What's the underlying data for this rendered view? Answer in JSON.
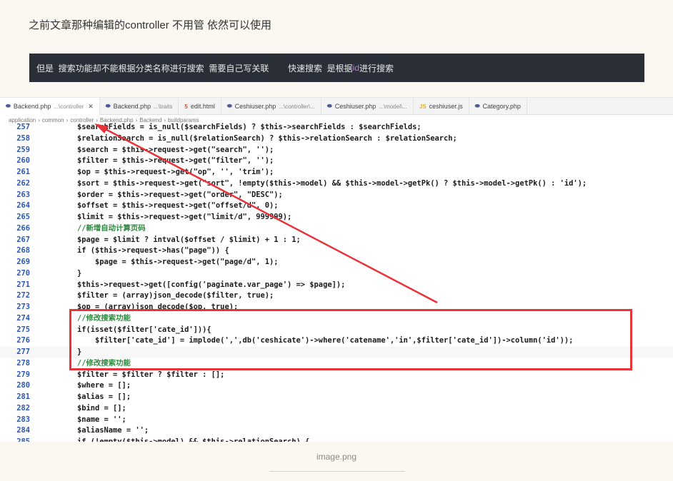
{
  "intro_text": "之前文章那种编辑的controller 不用管 依然可以使用",
  "quote": {
    "part1": "但是  搜索功能却不能根据分类名称进行搜索  需要自己写关联        快速搜索  是根据",
    "highlight": "id",
    "part2": "进行搜索"
  },
  "editor": {
    "tabs": [
      {
        "icon": "php-file-icon",
        "name": "Backend.php",
        "path": "...\\controller",
        "active": true,
        "close": "✕",
        "type": "php"
      },
      {
        "icon": "php-file-icon",
        "name": "Backend.php",
        "path": "...\\traits",
        "active": false,
        "type": "php"
      },
      {
        "icon": "html-file-icon",
        "name": "edit.html",
        "path": "",
        "active": false,
        "type": "html"
      },
      {
        "icon": "php-file-icon",
        "name": "Ceshiuser.php",
        "path": "...\\controller\\...",
        "active": false,
        "type": "php"
      },
      {
        "icon": "php-file-icon",
        "name": "Ceshiuser.php",
        "path": "...\\model\\...",
        "active": false,
        "type": "php"
      },
      {
        "icon": "js-file-icon",
        "name": "ceshiuser.js",
        "path": "",
        "active": false,
        "type": "js"
      },
      {
        "icon": "php-file-icon",
        "name": "Category.php",
        "path": "",
        "active": false,
        "type": "php"
      }
    ],
    "breadcrumb": [
      "application",
      "common",
      "controller",
      "Backend.php",
      "Backend",
      "buildparams"
    ],
    "code_lines": [
      {
        "n": "257",
        "t": "$searchFields = is_null($searchFields) ? $this->searchFields : $searchFields;"
      },
      {
        "n": "258",
        "t": "$relationSearch = is_null($relationSearch) ? $this->relationSearch : $relationSearch;"
      },
      {
        "n": "259",
        "t": "$search = $this->request->get(\"search\", '');"
      },
      {
        "n": "260",
        "t": "$filter = $this->request->get(\"filter\", '');"
      },
      {
        "n": "261",
        "t": "$op = $this->request->get(\"op\", '', 'trim');"
      },
      {
        "n": "262",
        "t": "$sort = $this->request->get(\"sort\", !empty($this->model) && $this->model->getPk() ? $this->model->getPk() : 'id');"
      },
      {
        "n": "263",
        "t": "$order = $this->request->get(\"order\", \"DESC\");"
      },
      {
        "n": "264",
        "t": "$offset = $this->request->get(\"offset/d\", 0);"
      },
      {
        "n": "265",
        "t": "$limit = $this->request->get(\"limit/d\", 999999);"
      },
      {
        "n": "266",
        "t": "//新增自动计算页码"
      },
      {
        "n": "267",
        "t": "$page = $limit ? intval($offset / $limit) + 1 : 1;"
      },
      {
        "n": "268",
        "t": "if ($this->request->has(\"page\")) {"
      },
      {
        "n": "269",
        "t": "    $page = $this->request->get(\"page/d\", 1);"
      },
      {
        "n": "270",
        "t": "}"
      },
      {
        "n": "271",
        "t": "$this->request->get([config('paginate.var_page') => $page]);"
      },
      {
        "n": "272",
        "t": "$filter = (array)json_decode($filter, true);"
      },
      {
        "n": "273",
        "t": "$op = (array)json_decode($op, true);"
      },
      {
        "n": "274",
        "t": "//修改搜索功能"
      },
      {
        "n": "275",
        "t": "if(isset($filter['cate_id'])){"
      },
      {
        "n": "276",
        "t": "    $filter['cate_id'] = implode(',',db('ceshicate')->where('catename','in',$filter['cate_id'])->column('id'));"
      },
      {
        "n": "277",
        "t": "}"
      },
      {
        "n": "278",
        "t": "//修改搜索功能"
      },
      {
        "n": "279",
        "t": "$filter = $filter ? $filter : [];"
      },
      {
        "n": "280",
        "t": "$where = [];"
      },
      {
        "n": "281",
        "t": "$alias = [];"
      },
      {
        "n": "282",
        "t": "$bind = [];"
      },
      {
        "n": "283",
        "t": "$name = '';"
      },
      {
        "n": "284",
        "t": "$aliasName = '';"
      },
      {
        "n": "285",
        "t": "if (!empty($this->model) && $this->relationSearch) {"
      }
    ],
    "annotation_color": "#e8333a"
  },
  "caption": "image.png"
}
